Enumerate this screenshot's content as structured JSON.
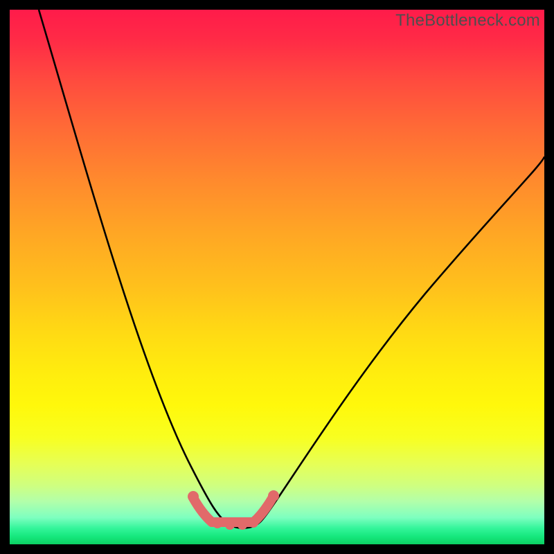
{
  "watermark": {
    "text": "TheBottleneck.com"
  },
  "chart_data": {
    "type": "line",
    "title": "",
    "xlabel": "",
    "ylabel": "",
    "xlim": [
      0,
      100
    ],
    "ylim": [
      0,
      100
    ],
    "series": [
      {
        "name": "bottleneck-curve",
        "x": [
          5,
          10,
          15,
          20,
          25,
          30,
          32,
          34,
          36,
          38,
          39,
          40,
          41,
          42,
          43,
          44,
          45,
          46,
          48,
          50,
          55,
          60,
          65,
          70,
          75,
          80,
          85,
          90,
          95,
          100
        ],
        "y": [
          100,
          88,
          76,
          64,
          51,
          36,
          29,
          22,
          15,
          8,
          5,
          3,
          1,
          0.5,
          0.5,
          1,
          2,
          4,
          8,
          12,
          22,
          30,
          37,
          43,
          48,
          52,
          55,
          58,
          60,
          62
        ]
      }
    ],
    "flat_region": {
      "x_start": 35,
      "x_end": 47,
      "y": 4,
      "note": "highlighted trough marker"
    },
    "colors": {
      "curve": "#000000",
      "trough_marker": "#e16a6a",
      "gradient_top": "#ff1b4a",
      "gradient_bottom": "#0cd062"
    }
  }
}
